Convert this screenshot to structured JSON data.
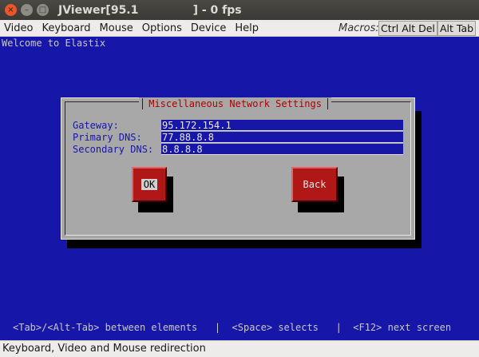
{
  "window": {
    "title": "JViewer[95.1              ] - 0 fps",
    "close_glyph": "×",
    "min_glyph": "–",
    "max_glyph": "□"
  },
  "menu": {
    "items": [
      {
        "label": "Video"
      },
      {
        "label": "Keyboard"
      },
      {
        "label": "Mouse"
      },
      {
        "label": "Options"
      },
      {
        "label": "Device"
      },
      {
        "label": "Help"
      }
    ],
    "macros_label": "Macros:",
    "macro_buttons": [
      {
        "label": "Ctrl Alt Del"
      },
      {
        "label": "Alt Tab"
      }
    ]
  },
  "console": {
    "welcome_text": "Welcome to Elastix",
    "background_color": "#1616a8",
    "dialog": {
      "title": " Miscellaneous Network Settings ",
      "fields": [
        {
          "label": "Gateway:",
          "value": "95.172.154.1"
        },
        {
          "label": "Primary DNS:",
          "value": "77.88.8.8"
        },
        {
          "label": "Secondary DNS:",
          "value": "8.8.8.8"
        }
      ],
      "ok_label": "OK",
      "back_label": "Back"
    },
    "hint": "<Tab>/<Alt-Tab> between elements   |  <Space> selects   |  <F12> next screen"
  },
  "status_bar": {
    "text": "Keyboard, Video and Mouse redirection"
  }
}
